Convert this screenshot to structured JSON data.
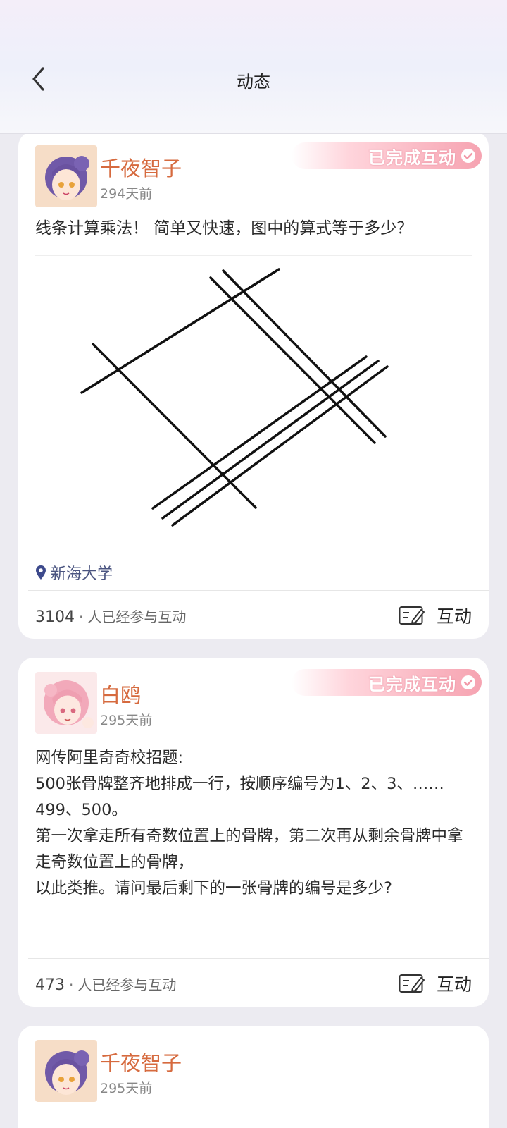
{
  "header": {
    "title": "动态"
  },
  "posts": [
    {
      "username": "千夜智子",
      "time": "294天前",
      "badge": "已完成互动",
      "text": "线条计算乘法！ 简单又快速，图中的算式等于多少？",
      "location": "新海大学",
      "participant_count": "3104",
      "participant_label": "人已经参与互动",
      "action_label": "互动"
    },
    {
      "username": "白鸥",
      "time": "295天前",
      "badge": "已完成互动",
      "text": "网传阿里奇奇校招题:\n500张骨牌整齐地排成一行，按顺序编号为1、2、3、……499、500。\n第一次拿走所有奇数位置上的骨牌，第二次再从剩余骨牌中拿走奇数位置上的骨牌，\n以此类推。请问最后剩下的一张骨牌的编号是多少?",
      "participant_count": "473",
      "participant_label": "人已经参与互动",
      "action_label": "互动"
    },
    {
      "username": "千夜智子",
      "time": "295天前"
    }
  ],
  "colors": {
    "username": "#d66a3e",
    "location": "#4a5480",
    "badge": "#f6a3b1"
  }
}
